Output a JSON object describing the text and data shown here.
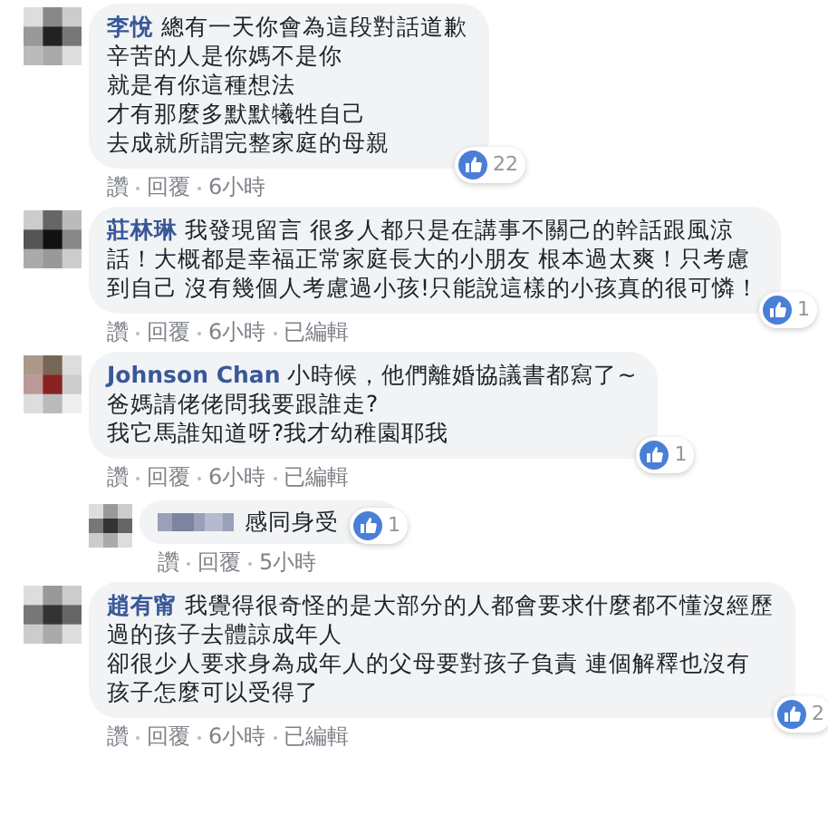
{
  "comments": [
    {
      "author": "李悅",
      "lines": [
        "總有一天你會為這段對話道歉",
        "辛苦的人是你媽不是你",
        "就是有你這種想法",
        "才有那麼多默默犧牲自己",
        "去成就所謂完整家庭的母親"
      ],
      "likes": "22",
      "actions": [
        "讚",
        "回覆",
        "6小時"
      ]
    },
    {
      "author": "莊林琳",
      "lines": [
        "我發現留言 很多人都只是在講事不關己的幹話跟風涼",
        "話！大概都是幸福正常家庭長大的小朋友 根本過太爽！只考慮",
        "到自己 沒有幾個人考慮過小孩!只能說這樣的小孩真的很可憐！"
      ],
      "likes": "1",
      "actions": [
        "讚",
        "回覆",
        "6小時",
        "已編輯"
      ]
    },
    {
      "author": "Johnson Chan",
      "lines": [
        "小時候，他們離婚協議書都寫了~",
        "爸媽請佬佬問我要跟誰走?",
        "我它馬誰知道呀?我才幼稚園耶我"
      ],
      "likes": "1",
      "actions": [
        "讚",
        "回覆",
        "6小時",
        "已編輯"
      ],
      "replies": [
        {
          "text": "感同身受",
          "likes": "1",
          "actions": [
            "讚",
            "回覆",
            "5小時"
          ]
        }
      ]
    },
    {
      "author": "趙有甯",
      "lines": [
        "我覺得很奇怪的是大部分的人都會要求什麼都不懂沒經歷",
        "過的孩子去體諒成年人",
        "卻很少人要求身為成年人的父母要對孩子負責 連個解釋也沒有",
        "孩子怎麼可以受得了"
      ],
      "likes": "2",
      "actions": [
        "讚",
        "回覆",
        "6小時",
        "已編輯"
      ]
    }
  ]
}
